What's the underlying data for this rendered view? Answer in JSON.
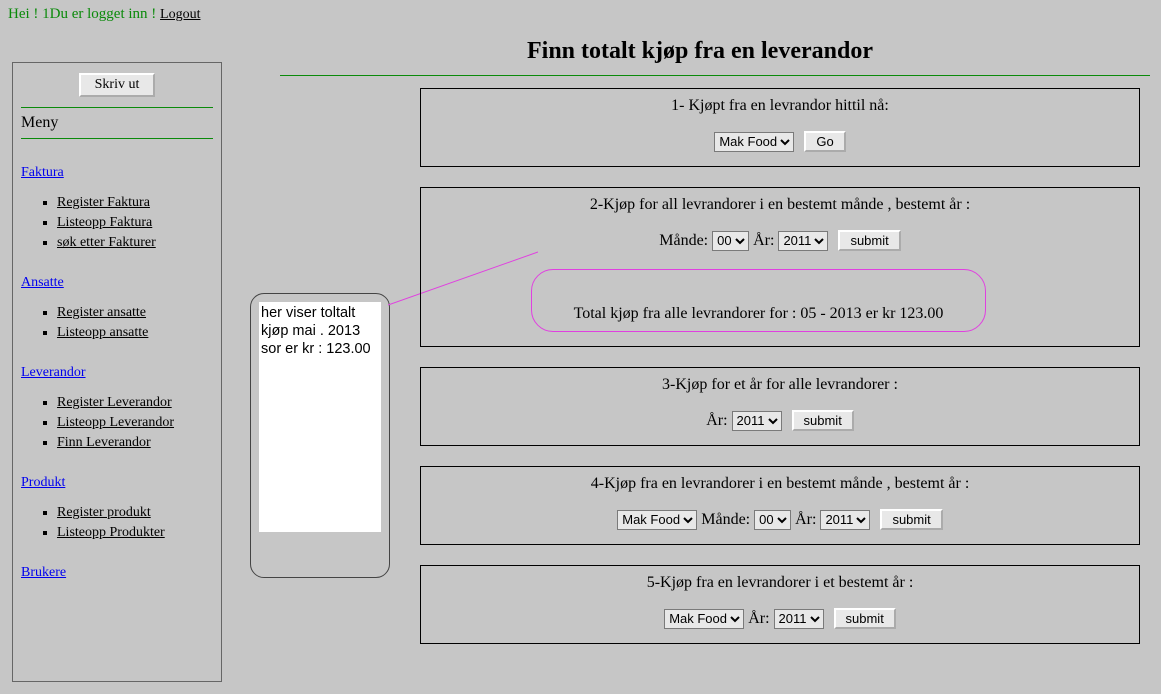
{
  "top": {
    "greeting_prefix": "Hei ! 1",
    "logged_in_text": "Du er logget inn !",
    "logout_label": "Logout"
  },
  "sidebar": {
    "print_label": "Skriv ut",
    "menu_title": "Meny",
    "sections": [
      {
        "head": "Faktura",
        "items": [
          "Register Faktura",
          "Listeopp Faktura",
          "søk etter Fakturer"
        ]
      },
      {
        "head": "Ansatte",
        "items": [
          "Register ansatte",
          "Listeopp ansatte"
        ]
      },
      {
        "head": "Leverandor",
        "items": [
          "Register Leverandor",
          "Listeopp Leverandor",
          "Finn Leverandor"
        ]
      },
      {
        "head": "Produkt",
        "items": [
          "Register produkt",
          "Listeopp Produkter"
        ]
      },
      {
        "head": "Brukere",
        "items": []
      }
    ]
  },
  "note": {
    "text": "her viser toltalt kjøp mai . 2013  sor er kr : 123.00"
  },
  "page": {
    "title": "Finn totalt kjøp fra en leverandor"
  },
  "form_common": {
    "month_label": "Månde:",
    "year_label": "År:",
    "supplier_selected": "Mak Food",
    "month_selected": "00",
    "year_selected": "2011",
    "go_label": "Go",
    "submit_label": "submit"
  },
  "sections": {
    "s1": {
      "label": "1- Kjøpt fra en levrandor hittil nå:"
    },
    "s2": {
      "label": "2-Kjøp for all levrandorer i en bestemt månde , bestemt år :",
      "result_text": "Total kjøp fra alle levrandorer for : 05 - 2013 er kr 123.00"
    },
    "s3": {
      "label": "3-Kjøp for et år for alle levrandorer :"
    },
    "s4": {
      "label": "4-Kjøp fra en levrandorer i en bestemt månde , bestemt år :"
    },
    "s5": {
      "label": "5-Kjøp fra en levrandorer i et bestemt år :"
    }
  }
}
